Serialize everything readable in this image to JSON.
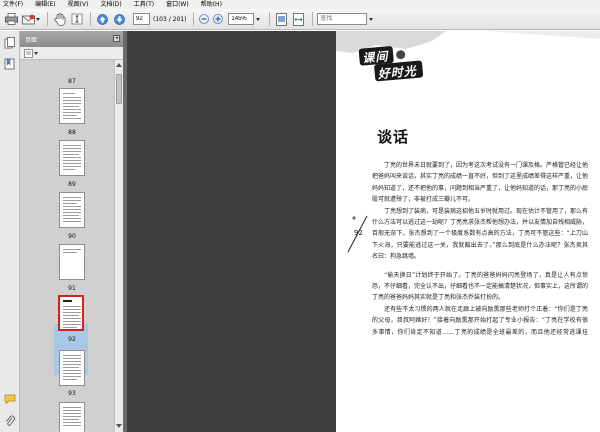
{
  "menu": [
    "文件(F)",
    "编辑(E)",
    "视图(V)",
    "文档(D)",
    "工具(T)",
    "窗口(W)",
    "帮助(H)"
  ],
  "toolbar": {
    "current_page": "92",
    "page_count": "(103 / 201)",
    "zoom": "145%",
    "search_placeholder": "查找"
  },
  "panel": {
    "title": "页面",
    "thumbnails": [
      {
        "label": "87"
      },
      {
        "label": "88"
      },
      {
        "label": "89"
      },
      {
        "label": "90"
      },
      {
        "label": "91"
      },
      {
        "label": "92",
        "selected": true
      },
      {
        "label": "93"
      }
    ]
  },
  "page": {
    "logo_line1": "课间",
    "logo_line2": "好时光",
    "heading": "谈话",
    "page_number": "92",
    "paragraphs": [
      "丁亮的世界末日就要到了，因为考这次考试没有一门课及格。严格管已经让他把爸妈叫来谈话，其实丁亮的成绩一直不好，但到了这里成绩差得这样严重，让他妈妈知道了，还不把他的事，问题到相当严重了，让他妈知道的话，那丁亮的小屁股可就遭殃了，非被打成三瓣儿不可。",
      "丁亮想到了装病，可是装病这招他五岁时就用过。现在估计不管用了，那么有什么方法可以逃过这一劫呢？丁亮亮求张杰帮他想办法，并以友情加自残相威胁，百般无奈下，张杰想到了一个极度系数有点高的方法，丁亮可不管这些：“上刀山下火海，只要能逃过这一关，我就豁出去了。”那么到底是什么办法呢？张杰卖其名曰：狗急跳墙。",
      "“偷天换日”计划终于开始了。丁亮的爸爸妈妈闪亮登场了，真是让人有点惊恐，不仔细看，完全认不出，仔细看也不一定能搞清楚状况，但事实上，这所谓的丁亮的爸爸妈妈其实就是丁亮和张杰乔装打扮的。",
      "还有些不太习惯的两人就在走廊上被向励熏那些老师打个正着：“你们是丁亮的父母，叔叔阿姨好！”接着向励熏那开始打起了专业小报告：“丁亮在学校有很多事情，你们肯定不知道……丁亮的成绩是全班最差的，而且他还经常逃课挂机……"
    ]
  }
}
